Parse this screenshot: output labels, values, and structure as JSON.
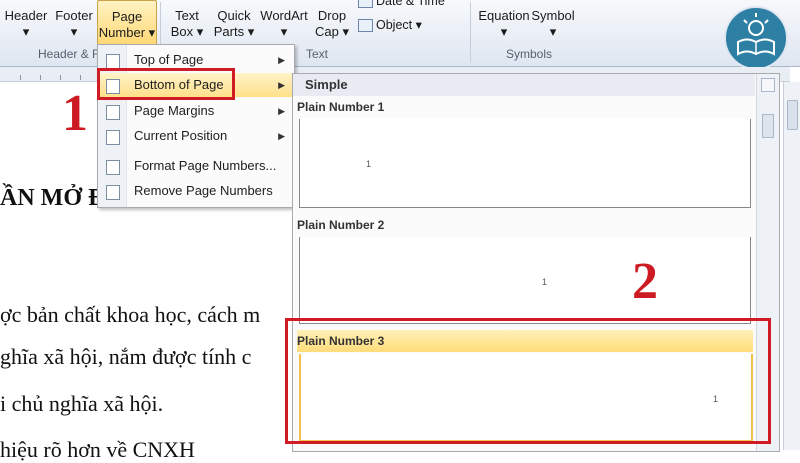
{
  "ribbon": {
    "buttons": {
      "header": "Header",
      "footer": "Footer",
      "page_number_l1": "Page",
      "page_number_l2": "Number",
      "text_box_l1": "Text",
      "text_box_l2": "Box",
      "quick_parts_l1": "Quick",
      "quick_parts_l2": "Parts",
      "wordart": "WordArt",
      "drop_cap_l1": "Drop",
      "drop_cap_l2": "Cap",
      "date_time": "Date & Time",
      "object": "Object",
      "equation": "Equation",
      "symbol": "Symbol"
    },
    "groups": {
      "header_footer": "Header & F",
      "text": "Text",
      "symbols": "Symbols"
    }
  },
  "menu": {
    "items": [
      {
        "label": "Top of Page"
      },
      {
        "label": "Bottom of Page"
      },
      {
        "label": "Page Margins"
      },
      {
        "label": "Current Position"
      },
      {
        "label": "Format Page Numbers..."
      },
      {
        "label": "Remove Page Numbers"
      }
    ]
  },
  "gallery": {
    "section": "Simple",
    "items": [
      {
        "title": "Plain Number 1",
        "preview_num": "1"
      },
      {
        "title": "Plain Number 2",
        "preview_num": "1"
      },
      {
        "title": "Plain Number 3",
        "preview_num": "1"
      }
    ]
  },
  "document": {
    "heading": "ẦN MỞ ĐẦU",
    "lines": [
      "ợc bản chất khoa học, cách m",
      "ghĩa xã hội, nắm được tính c",
      "i chủ nghĩa xã hội.",
      "  hiệu rõ hơn về CNXH"
    ]
  },
  "annotations": {
    "step1": "1",
    "step2": "2"
  },
  "colors": {
    "highlight": "#ffdc7a",
    "annotation_red": "#d11b24"
  }
}
